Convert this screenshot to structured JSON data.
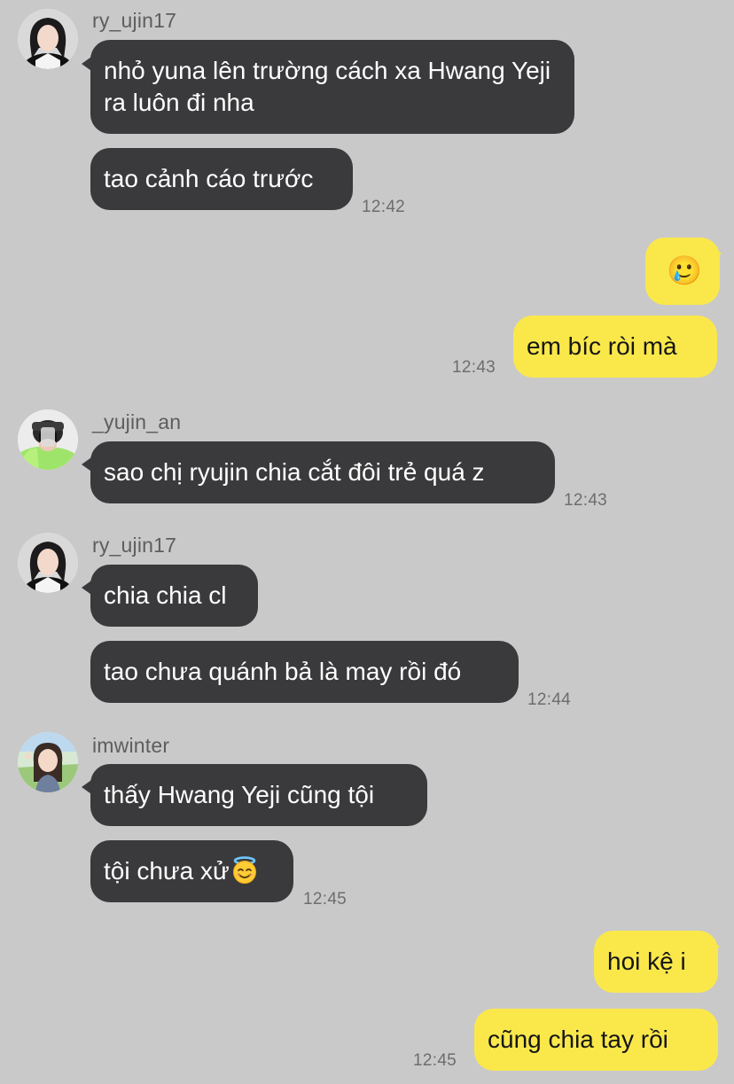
{
  "colors": {
    "background": "#c9c9c9",
    "incoming_bubble": "#3a3a3c",
    "outgoing_bubble": "#fae84b",
    "timestamp": "#6d6d6d",
    "sender_name": "#5e5e5e"
  },
  "messages": [
    {
      "sender": "ry_ujin17",
      "avatar": "avatar-ry-ujin17",
      "bubbles": [
        "nhỏ yuna lên trường cách xa Hwang Yeji ra luôn đi nha",
        "tao cảnh cáo trước"
      ],
      "time": "12:42"
    },
    {
      "outgoing": true,
      "bubbles": [
        "🥲",
        "em bíc ròi mà"
      ],
      "time": "12:43"
    },
    {
      "sender": "_yujin_an",
      "avatar": "avatar-yujin-an",
      "bubbles": [
        "sao chị ryujin chia cắt đôi trẻ quá z"
      ],
      "time": "12:43"
    },
    {
      "sender": "ry_ujin17",
      "avatar": "avatar-ry-ujin17",
      "bubbles": [
        "chia chia cl",
        "tao chưa quánh bả là may rồi đó"
      ],
      "time": "12:44"
    },
    {
      "sender": "imwinter",
      "avatar": "avatar-imwinter",
      "bubbles": [
        "thấy Hwang Yeji cũng tội",
        "tội chưa xử"
      ],
      "emoji_after_last": "smiling-face-with-halo-emoji",
      "time": "12:45"
    },
    {
      "outgoing": true,
      "bubbles": [
        "hoi kệ i",
        "cũng chia tay rồi"
      ],
      "time": "12:45"
    }
  ]
}
